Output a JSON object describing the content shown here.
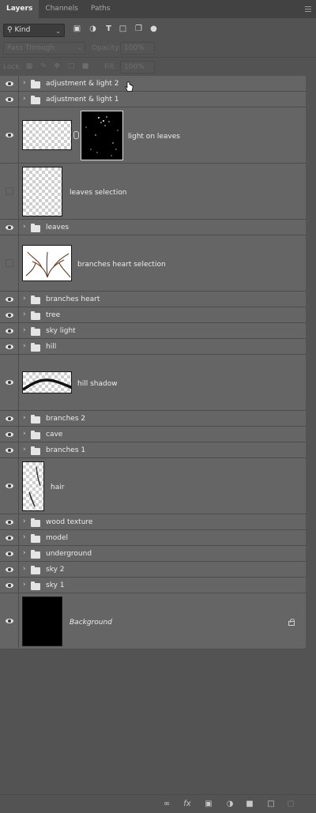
{
  "tabs": [
    {
      "label": "Layers",
      "active": true
    },
    {
      "label": "Channels",
      "active": false
    },
    {
      "label": "Paths",
      "active": false
    }
  ],
  "filter": {
    "kind_label": "Kind",
    "icons": [
      "pixel-filter-icon",
      "adjustment-filter-icon",
      "type-filter-icon",
      "shape-filter-icon",
      "smart-object-filter-icon",
      "filter-toggle-icon"
    ]
  },
  "blend": {
    "mode": "Pass Through",
    "opacity_label": "Opacity:",
    "opacity_value": "100%"
  },
  "lock": {
    "label": "Lock:",
    "icons": [
      "lock-transparent-icon",
      "lock-image-icon",
      "lock-position-icon",
      "lock-artboard-icon",
      "lock-all-icon"
    ],
    "fill_label": "Fill:",
    "fill_value": "100%"
  },
  "layers": [
    {
      "name": "adjustment & light 2",
      "type": "group",
      "visible": true
    },
    {
      "name": "adjustment & light 1",
      "type": "group",
      "visible": true
    },
    {
      "name": "light on leaves",
      "type": "pixel-mask",
      "visible": true
    },
    {
      "name": "leaves selection",
      "type": "pixel",
      "visible": false
    },
    {
      "name": "leaves",
      "type": "group",
      "visible": true
    },
    {
      "name": "branches heart selection",
      "type": "pixel",
      "visible": false
    },
    {
      "name": "branches heart",
      "type": "group",
      "visible": true
    },
    {
      "name": "tree",
      "type": "group",
      "visible": true
    },
    {
      "name": "sky light",
      "type": "group",
      "visible": true
    },
    {
      "name": "hill",
      "type": "group",
      "visible": true
    },
    {
      "name": "hill shadow",
      "type": "pixel",
      "visible": true
    },
    {
      "name": "branches 2",
      "type": "group",
      "visible": true
    },
    {
      "name": "cave",
      "type": "group",
      "visible": true
    },
    {
      "name": "branches 1",
      "type": "group",
      "visible": true
    },
    {
      "name": "hair",
      "type": "pixel",
      "visible": true
    },
    {
      "name": "wood texture",
      "type": "group",
      "visible": true
    },
    {
      "name": "model",
      "type": "group",
      "visible": true
    },
    {
      "name": "underground",
      "type": "group",
      "visible": true
    },
    {
      "name": "sky 2",
      "type": "group",
      "visible": true
    },
    {
      "name": "sky 1",
      "type": "group",
      "visible": true
    },
    {
      "name": "Background",
      "type": "background",
      "visible": true,
      "locked": true
    }
  ],
  "bottom_icons": [
    "link-layers-icon",
    "fx-icon",
    "add-mask-icon",
    "adjustment-layer-icon",
    "new-group-icon",
    "new-layer-icon",
    "delete-layer-icon"
  ]
}
